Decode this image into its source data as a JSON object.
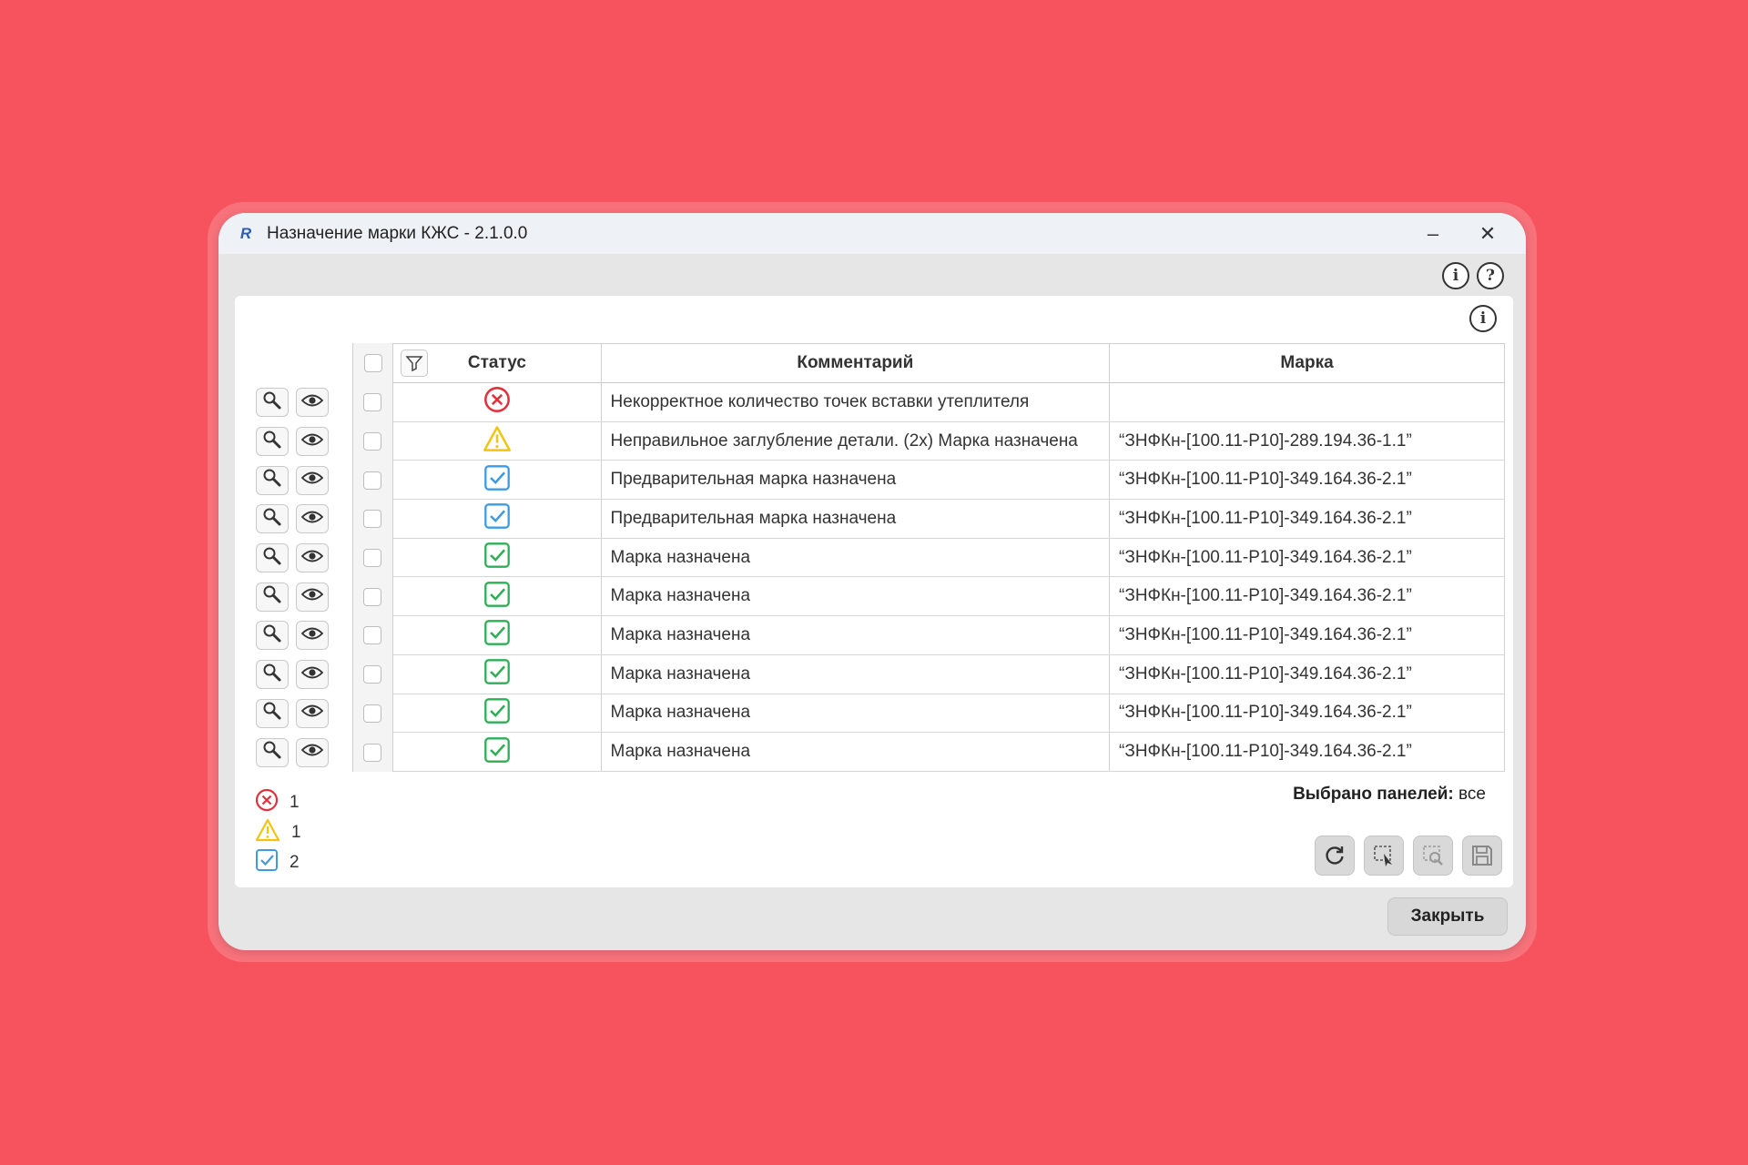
{
  "window": {
    "title": "Назначение марки КЖС - 2.1.0.0",
    "minimize_label": "–",
    "close_label": "✕"
  },
  "colors": {
    "background": "#f7535f",
    "error": "#e0323c",
    "warning": "#f1c40f",
    "preliminary": "#3f9be0",
    "ok": "#2fae55"
  },
  "icons": {
    "info": "info-icon",
    "help": "help-icon",
    "zoom": "magnifier-icon",
    "view": "eye-icon",
    "filter": "filter-icon",
    "refresh": "refresh-icon",
    "select": "select-area-icon",
    "zoom_area": "zoom-area-icon",
    "save": "save-icon"
  },
  "top_icons": {
    "info": "i",
    "help": "?"
  },
  "panel_info": "i",
  "table": {
    "columns": {
      "status": "Статус",
      "comment": "Комментарий",
      "mark": "Марка"
    },
    "rows": [
      {
        "status": "error",
        "comment": "Некорректное количество точек вставки утеплителя",
        "mark": ""
      },
      {
        "status": "warning",
        "comment": "Неправильное заглубление детали. (2x) Марка назначена",
        "mark": "“ЗНФКн-[100.11-Р10]-289.194.36-1.1”"
      },
      {
        "status": "preliminary",
        "comment": "Предварительная марка назначена",
        "mark": "“ЗНФКн-[100.11-Р10]-349.164.36-2.1”"
      },
      {
        "status": "preliminary",
        "comment": "Предварительная марка назначена",
        "mark": "“ЗНФКн-[100.11-Р10]-349.164.36-2.1”"
      },
      {
        "status": "ok",
        "comment": "Марка назначена",
        "mark": "“ЗНФКн-[100.11-Р10]-349.164.36-2.1”"
      },
      {
        "status": "ok",
        "comment": "Марка назначена",
        "mark": "“ЗНФКн-[100.11-Р10]-349.164.36-2.1”"
      },
      {
        "status": "ok",
        "comment": "Марка назначена",
        "mark": "“ЗНФКн-[100.11-Р10]-349.164.36-2.1”"
      },
      {
        "status": "ok",
        "comment": "Марка назначена",
        "mark": "“ЗНФКн-[100.11-Р10]-349.164.36-2.1”"
      },
      {
        "status": "ok",
        "comment": "Марка назначена",
        "mark": "“ЗНФКн-[100.11-Р10]-349.164.36-2.1”"
      },
      {
        "status": "ok",
        "comment": "Марка назначена",
        "mark": "“ЗНФКн-[100.11-Р10]-349.164.36-2.1”"
      }
    ]
  },
  "summary": {
    "error_count": "1",
    "warning_count": "1",
    "preliminary_count": "2"
  },
  "selected_panels": {
    "label": "Выбрано панелей:",
    "value": "все"
  },
  "buttons": {
    "close": "Закрыть"
  }
}
